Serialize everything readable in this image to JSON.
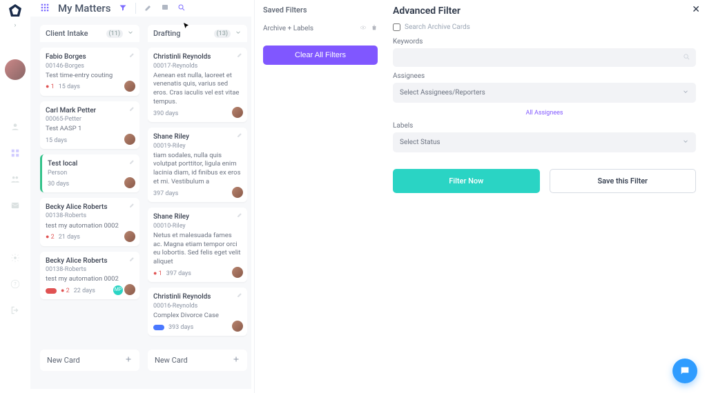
{
  "app_title": "My Matters",
  "sidebar": {},
  "columns": [
    {
      "title": "Client Intake",
      "count": "(11)",
      "newcard_label": "New Card",
      "cards": [
        {
          "name": "Fabio Borges",
          "ref": "00146-Borges",
          "desc": "Test time-entry couting",
          "alert": "● 1",
          "days": "15 days",
          "avatar": true
        },
        {
          "name": "Carl Mark Petter",
          "ref": "00065-Petter",
          "desc": "Test AASP 1",
          "days": "15 days",
          "avatar": true
        },
        {
          "name": "Test local",
          "ref": "Person",
          "days": "30 days",
          "avatar": true,
          "green": true
        },
        {
          "name": "Becky Alice Roberts",
          "ref": "00138-Roberts",
          "desc": "test my automation 0002",
          "alert": "● 2",
          "days": "21 days",
          "avatar": true
        },
        {
          "name": "Becky Alice Roberts",
          "ref": "00138-Roberts",
          "desc": "test my automation 0002",
          "days": "22 days",
          "avatar": true,
          "pills": [
            "red",
            "red2"
          ],
          "extra_avatar": "MP"
        }
      ]
    },
    {
      "title": "Drafting",
      "count": "(13)",
      "newcard_label": "New Card",
      "cards": [
        {
          "name": "Christinli Reynolds",
          "ref": "00017-Reynolds",
          "desc": "Aenean est nulla, laoreet et venenatis quis, varius sed eros. Cras iaculis vel est vitae tempus.",
          "days": "390 days",
          "avatar": true
        },
        {
          "name": "Shane Riley",
          "ref": "00019-Riley",
          "desc": "tiam sodales, nulla quis volutpat porttitor, ligula enim lacinia diam, id finibus ex eros et mi. Vestibulum a",
          "days": "397 days",
          "avatar": true
        },
        {
          "name": "Shane Riley",
          "ref": "00010-Riley",
          "desc": "Netus et malesuada fames ac. Magna etiam tempor orci eu lobortis. Sed felis eget velit aliquet",
          "alert": "● 1",
          "days": "397 days",
          "avatar": true
        },
        {
          "name": "Christinli Reynolds",
          "ref": "00016-Reynolds",
          "desc": "Complex Divorce Case",
          "days": "393 days",
          "avatar": true,
          "bluepill": true
        }
      ]
    }
  ],
  "saved": {
    "title": "Saved Filters",
    "item": "Archive + Labels",
    "clear_btn": "Clear All Filters"
  },
  "advanced": {
    "title": "Advanced Filter",
    "search_archive": "Search Archive Cards",
    "keywords_label": "Keywords",
    "assignees_label": "Assignees",
    "assignees_placeholder": "Select Assignees/Reporters",
    "all_assignees": "All Assignees",
    "labels_label": "Labels",
    "labels_placeholder": "Select Status",
    "filter_btn": "Filter Now",
    "save_btn": "Save this Filter"
  }
}
